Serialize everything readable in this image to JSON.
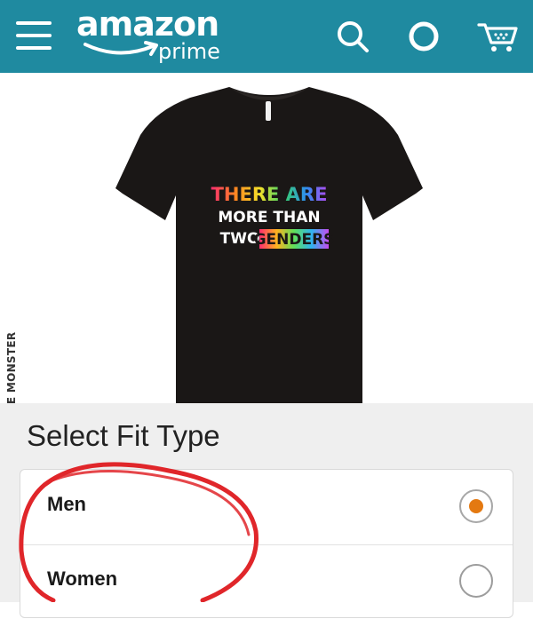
{
  "header": {
    "logo_word": "amazon",
    "logo_sub": "prime",
    "background_color": "#1f8aa0",
    "icons": [
      "menu-icon",
      "search-icon",
      "assistant-icon",
      "cart-icon"
    ]
  },
  "product": {
    "shirt_line1": "THERE ARE",
    "shirt_line2": "MORE THAN",
    "shirt_line3_a": "TWO",
    "shirt_line3_b": "GENDERS",
    "shirt_color": "#1a1716"
  },
  "watermark": {
    "text": "JOE MONSTER"
  },
  "fit_selector": {
    "title": "Select Fit Type",
    "options": [
      {
        "label": "Men",
        "selected": true
      },
      {
        "label": "Women",
        "selected": false
      }
    ],
    "selected_color": "#e47911"
  },
  "annotation": {
    "color": "#e0262a"
  }
}
